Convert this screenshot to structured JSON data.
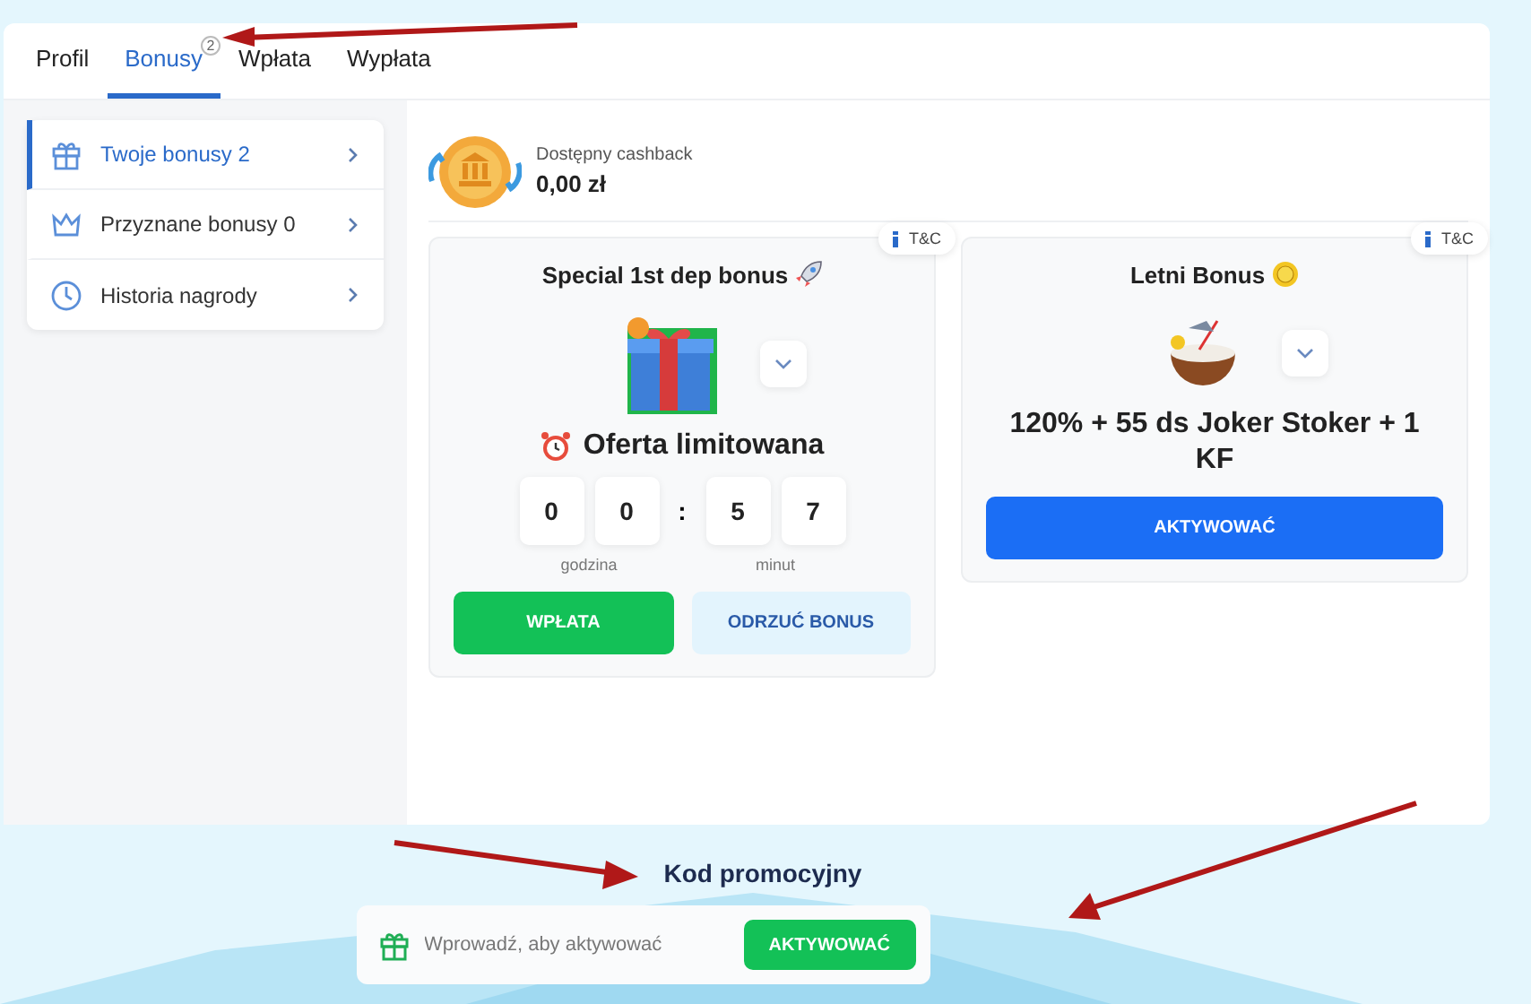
{
  "tabs": [
    {
      "label": "Profil",
      "selected": false
    },
    {
      "label": "Bonusy",
      "selected": true,
      "badge": "2"
    },
    {
      "label": "Wpłata",
      "selected": false
    },
    {
      "label": "Wypłata",
      "selected": false
    }
  ],
  "sidebar": {
    "items": [
      {
        "kind": "gift",
        "label": "Twoje bonusy",
        "count": "2",
        "selected": true
      },
      {
        "kind": "crown",
        "label": "Przyznane bonusy",
        "count": "0",
        "selected": false
      },
      {
        "kind": "clock",
        "label": "Historia nagrody",
        "selected": false
      }
    ]
  },
  "cashback": {
    "label": "Dostępny cashback",
    "amount": "0,00 zł"
  },
  "bonuses": [
    {
      "kind": "timer",
      "tc": "T&C",
      "title": "Special 1st dep bonus",
      "headline": "Oferta limitowana",
      "digits": [
        "0",
        "0",
        "5",
        "7"
      ],
      "separator": ":",
      "units": [
        "godzina",
        "minut"
      ],
      "buttons": [
        {
          "kind": "primary",
          "label": "WPŁATA"
        },
        {
          "kind": "secondary",
          "label": "ODRZUĆ BONUS"
        }
      ]
    },
    {
      "kind": "offer",
      "tc": "T&C",
      "title": "Letni Bonus",
      "headline": "120% + 55 ds Joker Stoker + 1 KF",
      "buttons": [
        {
          "kind": "activate",
          "label": "AKTYWOWAĆ"
        }
      ]
    }
  ],
  "promo": {
    "title": "Kod promocyjny",
    "placeholder": "Wprowadź, aby aktywować",
    "button": "AKTYWOWAĆ"
  }
}
